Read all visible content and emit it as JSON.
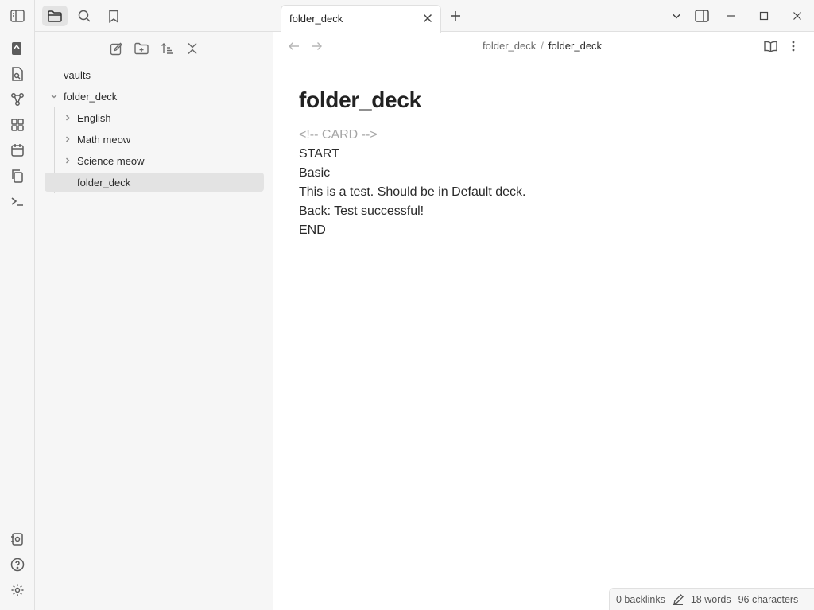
{
  "sidebar": {
    "tree": {
      "root": "vaults",
      "folder": "folder_deck",
      "children": [
        "English",
        "Math meow",
        "Science meow"
      ],
      "selected_file": "folder_deck"
    }
  },
  "tabs": [
    {
      "title": "folder_deck"
    }
  ],
  "breadcrumb": {
    "parent": "folder_deck",
    "separator": "/",
    "current": "folder_deck"
  },
  "note": {
    "title": "folder_deck",
    "lines": [
      "<!-- CARD -->",
      "START",
      "Basic",
      "This is a test. Should be in Default deck.",
      "Back: Test successful!",
      "END"
    ]
  },
  "status": {
    "backlinks": "0 backlinks",
    "words": "18 words",
    "characters": "96 characters"
  }
}
